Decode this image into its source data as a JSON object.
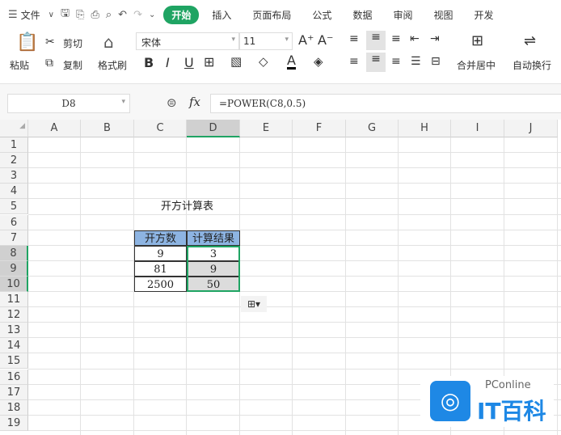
{
  "menubar": {
    "file": "文件",
    "tabs": [
      "开始",
      "插入",
      "页面布局",
      "公式",
      "数据",
      "审阅",
      "视图",
      "开发"
    ]
  },
  "ribbon": {
    "paste": "粘贴",
    "cut": "剪切",
    "copy": "复制",
    "format_painter": "格式刷",
    "font_name": "宋体",
    "font_size": "11",
    "merge_center": "合并居中",
    "wrap_text": "自动换行",
    "bold": "B",
    "italic": "I",
    "underline": "U"
  },
  "formula_bar": {
    "cell_ref": "D8",
    "fx": "fx",
    "formula": "=POWER(C8,0.5)"
  },
  "grid": {
    "columns": [
      "A",
      "B",
      "C",
      "D",
      "E",
      "F",
      "G",
      "H",
      "I",
      "J"
    ],
    "rows": [
      "1",
      "2",
      "3",
      "4",
      "5",
      "6",
      "7",
      "8",
      "9",
      "10",
      "11",
      "12",
      "13",
      "14",
      "15",
      "16",
      "17",
      "18",
      "19"
    ],
    "selected_column": "D",
    "selected_rows": [
      "8",
      "9",
      "10"
    ],
    "title": "开方计算表",
    "headers": [
      "开方数",
      "计算结果"
    ],
    "data": [
      [
        "9",
        "3"
      ],
      [
        "81",
        "9"
      ],
      [
        "2500",
        "50"
      ]
    ],
    "header_fill": "#8db4e2",
    "selection_color": "#1fa463"
  },
  "watermark": {
    "brand": "PConline",
    "name": "IT百科"
  }
}
